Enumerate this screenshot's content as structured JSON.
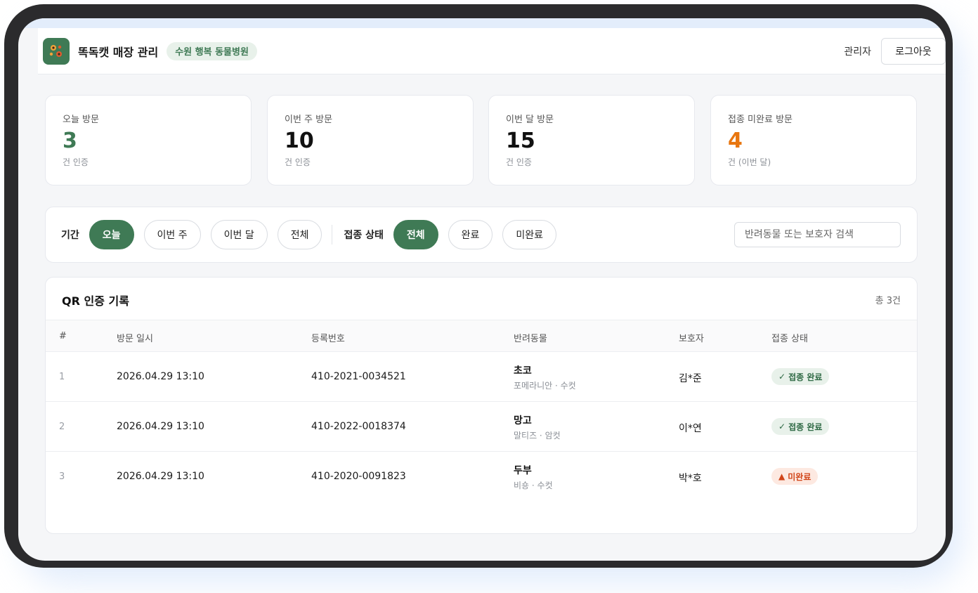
{
  "header": {
    "brand": "똑독캣 매장 관리",
    "clinic": "수원 행복 동물병원",
    "admin_label": "관리자",
    "logout_label": "로그아웃"
  },
  "colors": {
    "accent": "#3f7a55",
    "warning": "#e8760f",
    "pending_badge": "#d1461a"
  },
  "stats": [
    {
      "label": "오늘 방문",
      "value": "3",
      "sub": "건 인증",
      "color": "#3f7a55"
    },
    {
      "label": "이번 주 방문",
      "value": "10",
      "sub": "건 인증",
      "color": "#111111"
    },
    {
      "label": "이번 달 방문",
      "value": "15",
      "sub": "건 인증",
      "color": "#111111"
    },
    {
      "label": "접종 미완료 방문",
      "value": "4",
      "sub": "건 (이번 달)",
      "color": "#e8760f"
    }
  ],
  "filters": {
    "period_label": "기간",
    "period_options": [
      "오늘",
      "이번 주",
      "이번 달",
      "전체"
    ],
    "period_selected": "오늘",
    "status_label": "접종 상태",
    "status_options": [
      "전체",
      "완료",
      "미완료"
    ],
    "status_selected": "전체",
    "search_placeholder": "반려동물 또는 보호자 검색"
  },
  "table": {
    "title": "QR 인증 기록",
    "count": "총 3건",
    "columns": [
      "#",
      "방문 일시",
      "등록번호",
      "반려동물",
      "보호자",
      "접종 상태"
    ],
    "rows": [
      {
        "index": "1",
        "datetime": "2026.04.29 13:10",
        "reg_no": "410-2021-0034521",
        "pet_name": "초코",
        "pet_info": "포메라니안 · 수컷",
        "owner": "김*준",
        "status": "접종 완료",
        "status_type": "done",
        "status_icon": "check-icon"
      },
      {
        "index": "2",
        "datetime": "2026.04.29 13:10",
        "reg_no": "410-2022-0018374",
        "pet_name": "망고",
        "pet_info": "말티즈 · 암컷",
        "owner": "이*연",
        "status": "접종 완료",
        "status_type": "done",
        "status_icon": "check-icon"
      },
      {
        "index": "3",
        "datetime": "2026.04.29 13:10",
        "reg_no": "410-2020-0091823",
        "pet_name": "두부",
        "pet_info": "비숑 · 수컷",
        "owner": "박*호",
        "status": "미완료",
        "status_type": "pending",
        "status_icon": "warning-icon"
      }
    ]
  }
}
